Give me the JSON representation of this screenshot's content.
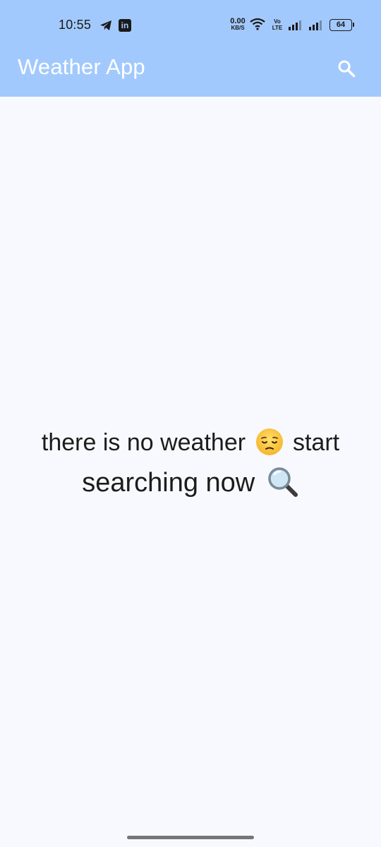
{
  "status_bar": {
    "time": "10:55",
    "linkedin_label": "in",
    "net_speed_value": "0.00",
    "net_speed_unit": "KB/S",
    "volte_top": "Vo",
    "volte_bottom": "LTE",
    "battery": "64"
  },
  "app_bar": {
    "title": "Weather App",
    "search_icon": "search-icon"
  },
  "empty_state": {
    "line1_before": "there is no weather",
    "line1_after": "start",
    "line2": "searching now",
    "emoji_pensive": "pensive-face-emoji",
    "emoji_magnifier": "magnifying-glass-emoji"
  },
  "colors": {
    "app_bar_bg": "#a2c9fd",
    "page_bg": "#f8f9fe",
    "title_text": "#ffffff",
    "body_text": "#1c1c1c"
  }
}
